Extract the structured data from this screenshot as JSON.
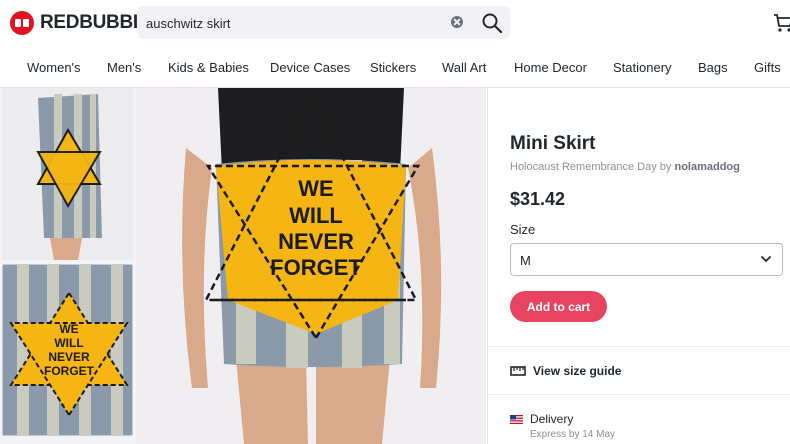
{
  "header": {
    "logo_text": "REDBUBBLE",
    "search": {
      "value": "auschwitz skirt",
      "placeholder": ""
    }
  },
  "nav": {
    "items": [
      {
        "label": "Women's"
      },
      {
        "label": "Men's"
      },
      {
        "label": "Kids & Babies"
      },
      {
        "label": "Device Cases"
      },
      {
        "label": "Stickers"
      },
      {
        "label": "Wall Art"
      },
      {
        "label": "Home Decor"
      },
      {
        "label": "Stationery"
      },
      {
        "label": "Bags"
      },
      {
        "label": "Gifts"
      }
    ]
  },
  "design": {
    "text_lines": [
      "WE",
      "WILL",
      "NEVER",
      "FORGET"
    ],
    "colors": {
      "yellow": "#f5b512",
      "stripe_gray": "#8a9aab",
      "stripe_light": "#c8cbbd",
      "black": "#1b1b1b"
    }
  },
  "product": {
    "title": "Mini Skirt",
    "subtitle_prefix": "Holocaust Remembrance Day by ",
    "artist": "nolamaddog",
    "price": "$31.42",
    "size_label": "Size",
    "size_value": "M",
    "add_to_cart": "Add to cart",
    "size_guide": "View size guide",
    "delivery_title": "Delivery",
    "delivery_sub": "Express by 14 May"
  },
  "colors": {
    "brand_red": "#e41321",
    "cta": "#e84360"
  },
  "icons": [
    "logo-mark-icon",
    "clear-icon",
    "search-icon",
    "cart-icon",
    "chevron-down-icon",
    "ruler-icon",
    "us-flag-icon"
  ]
}
